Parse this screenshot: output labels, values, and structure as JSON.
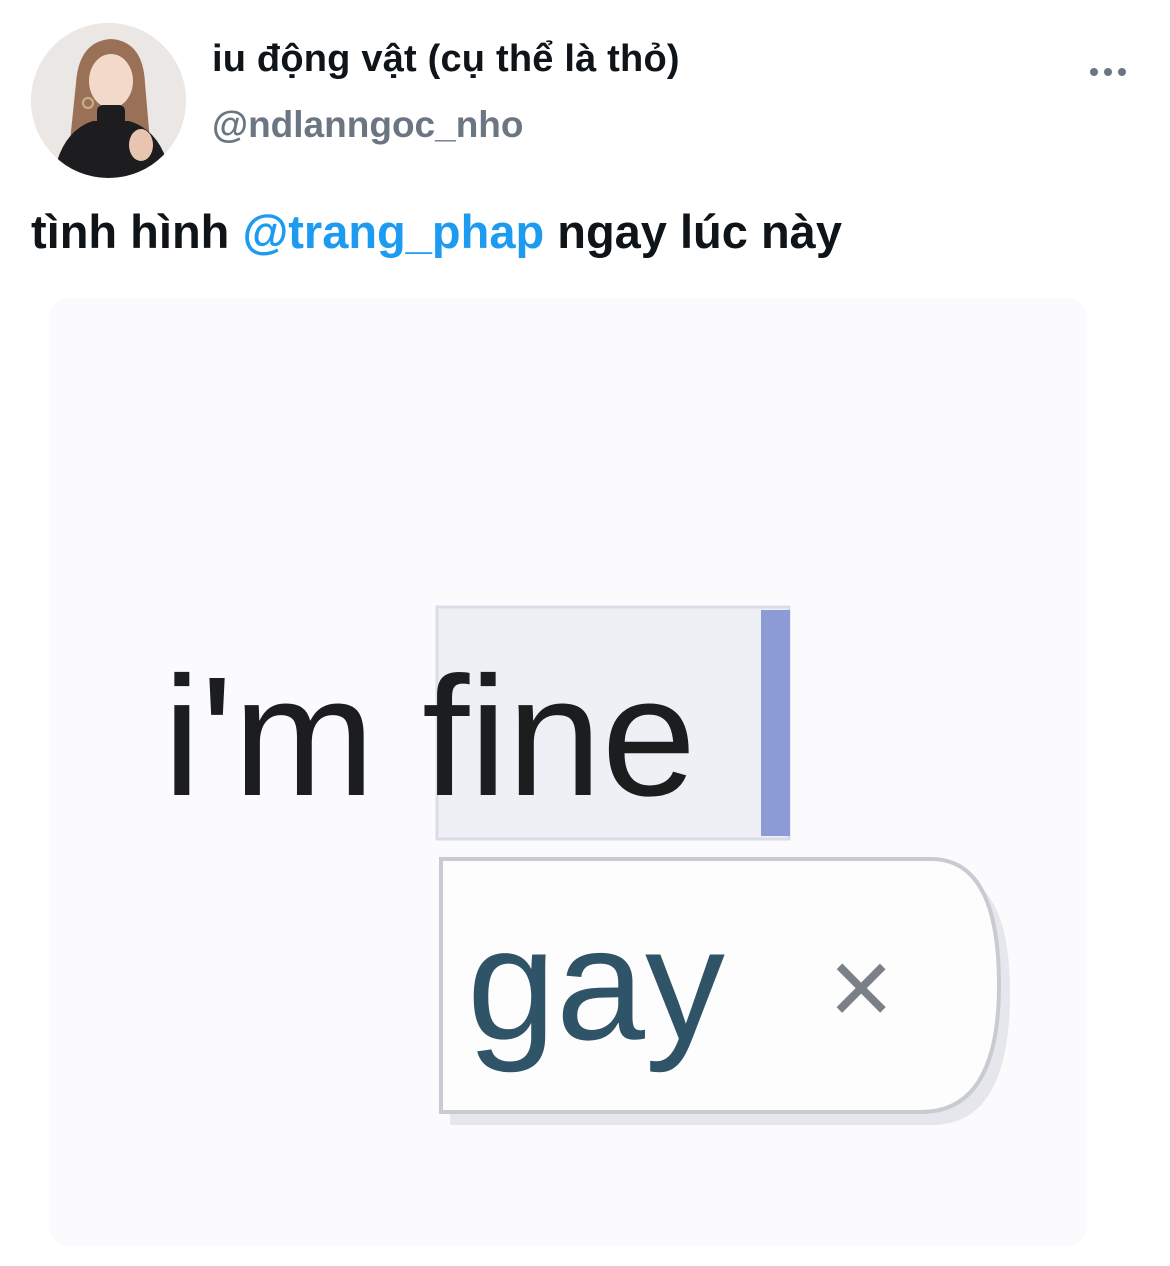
{
  "tweet": {
    "author": {
      "display_name": "iu động vật (cụ thể là thỏ)",
      "handle": "@ndlanngoc_nho"
    },
    "more_label": "•••",
    "text": {
      "before": "tình hình ",
      "mention": "@trang_phap",
      "after": " ngay lúc này"
    },
    "media": {
      "typed_prefix": "i'm ",
      "typed_word": "fine",
      "suggestion": "gay",
      "dismiss_symbol": "×"
    }
  },
  "colors": {
    "mention": "#1d9bf0",
    "handle": "#6b7682",
    "text": "#0f1419",
    "cursor": "#8c9ad6",
    "suggestion_text": "#2f5468"
  }
}
